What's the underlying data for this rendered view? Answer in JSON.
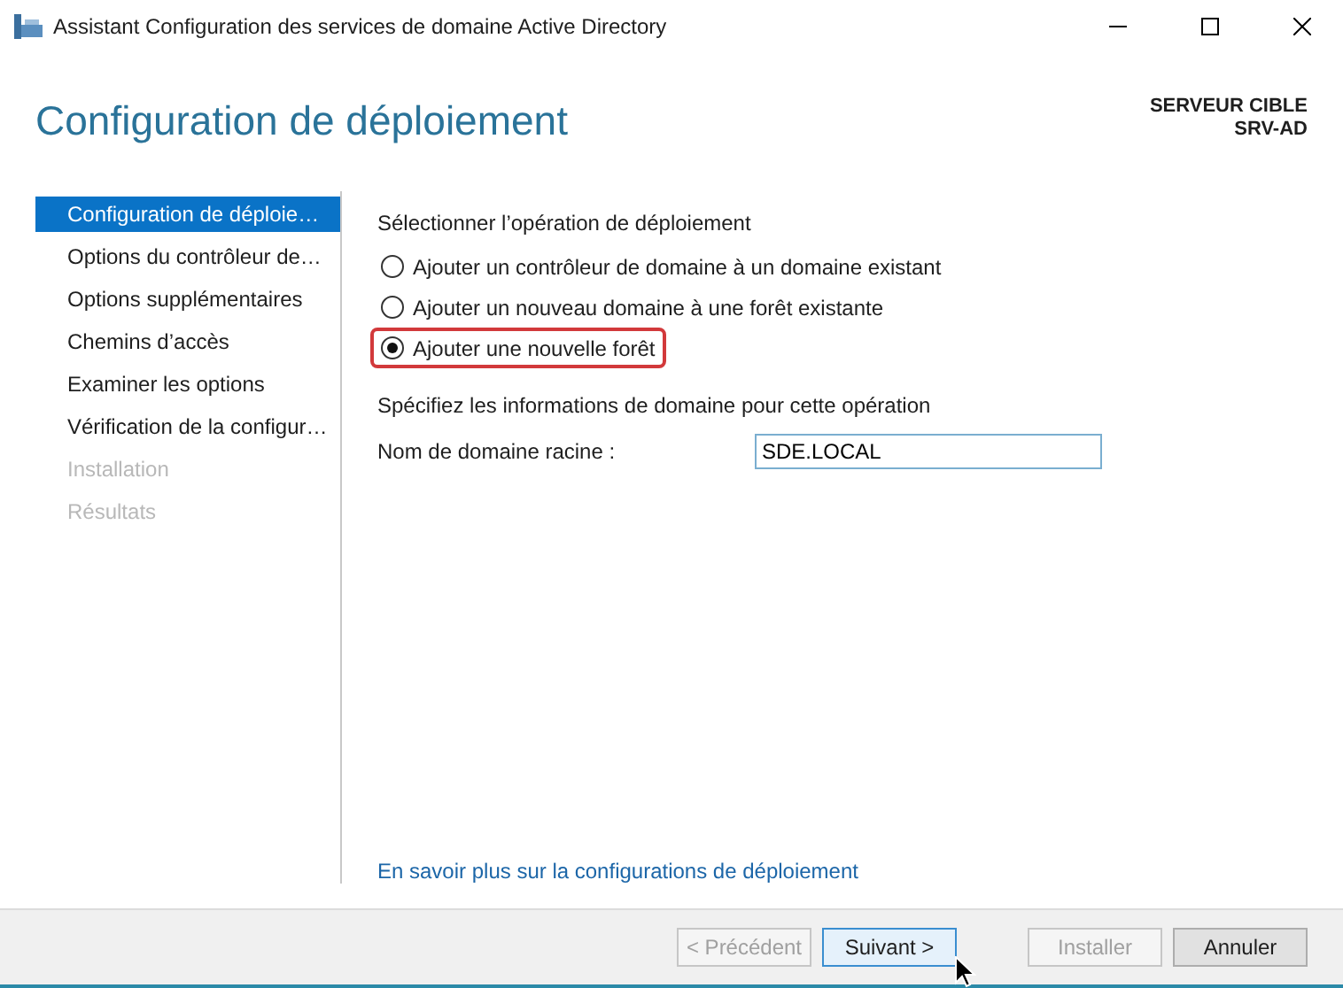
{
  "window": {
    "title": "Assistant Configuration des services de domaine Active Directory"
  },
  "header": {
    "title": "Configuration de déploiement",
    "target_label": "SERVEUR CIBLE",
    "target_name": "SRV-AD"
  },
  "sidebar": {
    "items": [
      {
        "label": "Configuration de déploie…",
        "selected": true,
        "disabled": false
      },
      {
        "label": "Options du contrôleur de…",
        "selected": false,
        "disabled": false
      },
      {
        "label": "Options supplémentaires",
        "selected": false,
        "disabled": false
      },
      {
        "label": "Chemins d’accès",
        "selected": false,
        "disabled": false
      },
      {
        "label": "Examiner les options",
        "selected": false,
        "disabled": false
      },
      {
        "label": "Vérification de la configur…",
        "selected": false,
        "disabled": false
      },
      {
        "label": "Installation",
        "selected": false,
        "disabled": true
      },
      {
        "label": "Résultats",
        "selected": false,
        "disabled": true
      }
    ]
  },
  "content": {
    "operation_heading": "Sélectionner l’opération de déploiement",
    "options": [
      {
        "label": "Ajouter un contrôleur de domaine à un domaine existant",
        "selected": false,
        "highlighted": false
      },
      {
        "label": "Ajouter un nouveau domaine à une forêt existante",
        "selected": false,
        "highlighted": false
      },
      {
        "label": "Ajouter une nouvelle forêt",
        "selected": true,
        "highlighted": true
      }
    ],
    "domain_heading": "Spécifiez les informations de domaine pour cette opération",
    "root_domain": {
      "label": "Nom de domaine racine :",
      "value": "SDE.LOCAL"
    },
    "link": "En savoir plus sur la configurations de déploiement"
  },
  "buttons": [
    {
      "label": "< Précédent",
      "disabled": true,
      "focused": false
    },
    {
      "label": "Suivant >",
      "disabled": false,
      "focused": true
    },
    {
      "label": "Installer",
      "disabled": true,
      "focused": false
    },
    {
      "label": "Annuler",
      "disabled": false,
      "focused": false
    }
  ]
}
